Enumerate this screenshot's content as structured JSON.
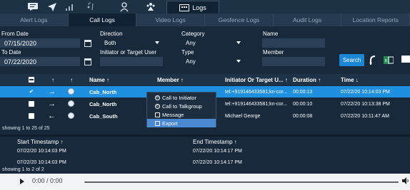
{
  "toolbar": {
    "icons": [
      "message-icon",
      "location-arrow-icon",
      "signal-icon",
      "user-pin-icon",
      "group-icon",
      "phone-icon"
    ],
    "active_label": "Logs"
  },
  "tabs": [
    {
      "label": "Alert Logs",
      "active": false
    },
    {
      "label": "Call Logs",
      "active": true
    },
    {
      "label": "Video Logs",
      "active": false
    },
    {
      "label": "Geofence Logs",
      "active": false
    },
    {
      "label": "Audit Logs",
      "active": false
    },
    {
      "label": "Location Reports",
      "active": false
    }
  ],
  "filters": {
    "from_date_label": "From Date",
    "from_date_value": "07/15/2020",
    "to_date_label": "To Date",
    "to_date_value": "07/22/2020",
    "direction_label": "Direction",
    "direction_value": "Both",
    "initiator_label": "Initiator or Target User",
    "initiator_value": "",
    "category_label": "Category",
    "category_value": "Any",
    "type_label": "Type",
    "type_value": "Any",
    "name_label": "Name",
    "name_value": "",
    "member_label": "Member",
    "member_value": "",
    "search_label": "Search"
  },
  "call_grid": {
    "headers": {
      "sort1": "↑",
      "sort2": "↑",
      "name": "Name ↑",
      "member": "Member ↑",
      "initiator": "Initiator Or Target U... ↑",
      "duration": "Duration ↑",
      "time": "Time ↓"
    },
    "rows": [
      {
        "name": "Cab_North",
        "member": "",
        "initiator": "tel:+919146433581;kn-cor...",
        "duration": "00:00:13",
        "time": "07/22/20 10:14:03 PM",
        "selected": true,
        "direction": "→"
      },
      {
        "name": "Cab_North",
        "member": "",
        "initiator": "tel:+919146433581;kn-cor...",
        "duration": "00:00:10",
        "time": "07/22/20 10:13:38 PM",
        "selected": false,
        "direction": "→"
      },
      {
        "name": "Cab_South",
        "member": "",
        "initiator": "Michael George",
        "duration": "00:00:08",
        "time": "07/22/20 10:11:47 AM",
        "selected": false,
        "direction": "←"
      }
    ],
    "showing": "showing 1 to 25 of 25"
  },
  "context_menu": {
    "items": [
      {
        "label": "Call to Initiator",
        "icon": "phone-circle-icon"
      },
      {
        "label": "Call to Talkgroup",
        "icon": "phone-circle-icon"
      },
      {
        "label": "Message",
        "icon": "message-icon"
      },
      {
        "label": "Export",
        "icon": "export-icon"
      }
    ],
    "active_index": 3
  },
  "timestamps_grid": {
    "headers": {
      "start": "Start Timestamp ↑",
      "end": "End Timestamp ↑"
    },
    "rows": [
      {
        "start": "07/22/20 10:14:03 PM",
        "end": "07/22/20 10:14:17 PM"
      },
      {
        "start": "07/22/20 10:14:03 PM",
        "end": "07/22/20 10:14:17 PM"
      }
    ],
    "showing": "showing 1 to 2 of 2"
  },
  "player": {
    "time": "0:00 / 0:00",
    "progress": 0
  }
}
